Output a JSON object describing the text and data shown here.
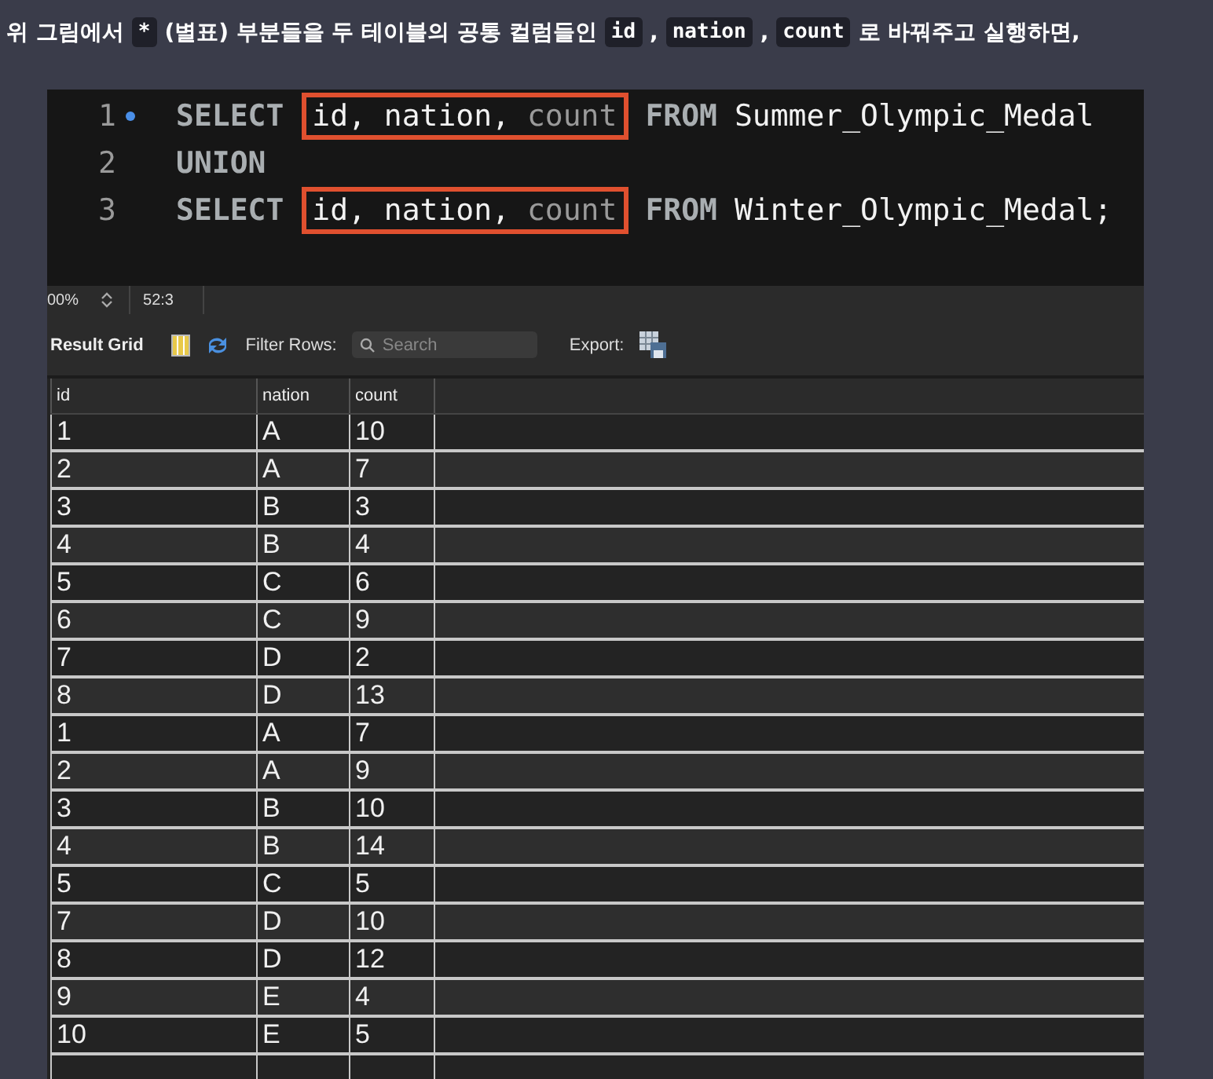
{
  "intro": {
    "segments": [
      {
        "kind": "text",
        "text": "위 그림에서"
      },
      {
        "kind": "code",
        "text": "*"
      },
      {
        "kind": "text",
        "text": "(별표) 부분들을 두 테이블의 공통 컬럼들인"
      },
      {
        "kind": "code",
        "text": "id"
      },
      {
        "kind": "text",
        "text": ","
      },
      {
        "kind": "code",
        "text": "nation"
      },
      {
        "kind": "text",
        "text": ","
      },
      {
        "kind": "code",
        "text": "count"
      },
      {
        "kind": "text",
        "text": "로 바꿔주고 실행하면,"
      }
    ]
  },
  "editor": {
    "lines": [
      {
        "number": "1",
        "marker": true,
        "segments": [
          {
            "kind": "keyword",
            "text": "SELECT"
          },
          {
            "kind": "boxed",
            "parts": [
              {
                "kind": "plain",
                "text": "id, nation,"
              },
              {
                "kind": "dim",
                "text": "count"
              }
            ]
          },
          {
            "kind": "keyword",
            "text": "FROM"
          },
          {
            "kind": "plain",
            "text": "Summer_Olympic_Medal"
          }
        ]
      },
      {
        "number": "2",
        "marker": false,
        "segments": [
          {
            "kind": "keyword",
            "text": "UNION"
          }
        ]
      },
      {
        "number": "3",
        "marker": false,
        "segments": [
          {
            "kind": "keyword",
            "text": "SELECT"
          },
          {
            "kind": "boxed",
            "parts": [
              {
                "kind": "plain",
                "text": "id, nation,"
              },
              {
                "kind": "dim",
                "text": "count"
              }
            ]
          },
          {
            "kind": "keyword",
            "text": "FROM"
          },
          {
            "kind": "plain",
            "text": "Winter_Olympic_Medal;"
          }
        ]
      }
    ]
  },
  "status_bar": {
    "zoom": "00%",
    "position": "52:3"
  },
  "toolbar": {
    "result_grid": "Result Grid",
    "filter_label": "Filter Rows:",
    "search": {
      "placeholder": "Search"
    },
    "export_label": "Export:"
  },
  "table": {
    "columns": [
      "id",
      "nation",
      "count"
    ],
    "rows": [
      [
        "1",
        "A",
        "10"
      ],
      [
        "2",
        "A",
        "7"
      ],
      [
        "3",
        "B",
        "3"
      ],
      [
        "4",
        "B",
        "4"
      ],
      [
        "5",
        "C",
        "6"
      ],
      [
        "6",
        "C",
        "9"
      ],
      [
        "7",
        "D",
        "2"
      ],
      [
        "8",
        "D",
        "13"
      ],
      [
        "1",
        "A",
        "7"
      ],
      [
        "2",
        "A",
        "9"
      ],
      [
        "3",
        "B",
        "10"
      ],
      [
        "4",
        "B",
        "14"
      ],
      [
        "5",
        "C",
        "5"
      ],
      [
        "7",
        "D",
        "10"
      ],
      [
        "8",
        "D",
        "12"
      ],
      [
        "9",
        "E",
        "4"
      ],
      [
        "10",
        "E",
        "5"
      ]
    ]
  }
}
